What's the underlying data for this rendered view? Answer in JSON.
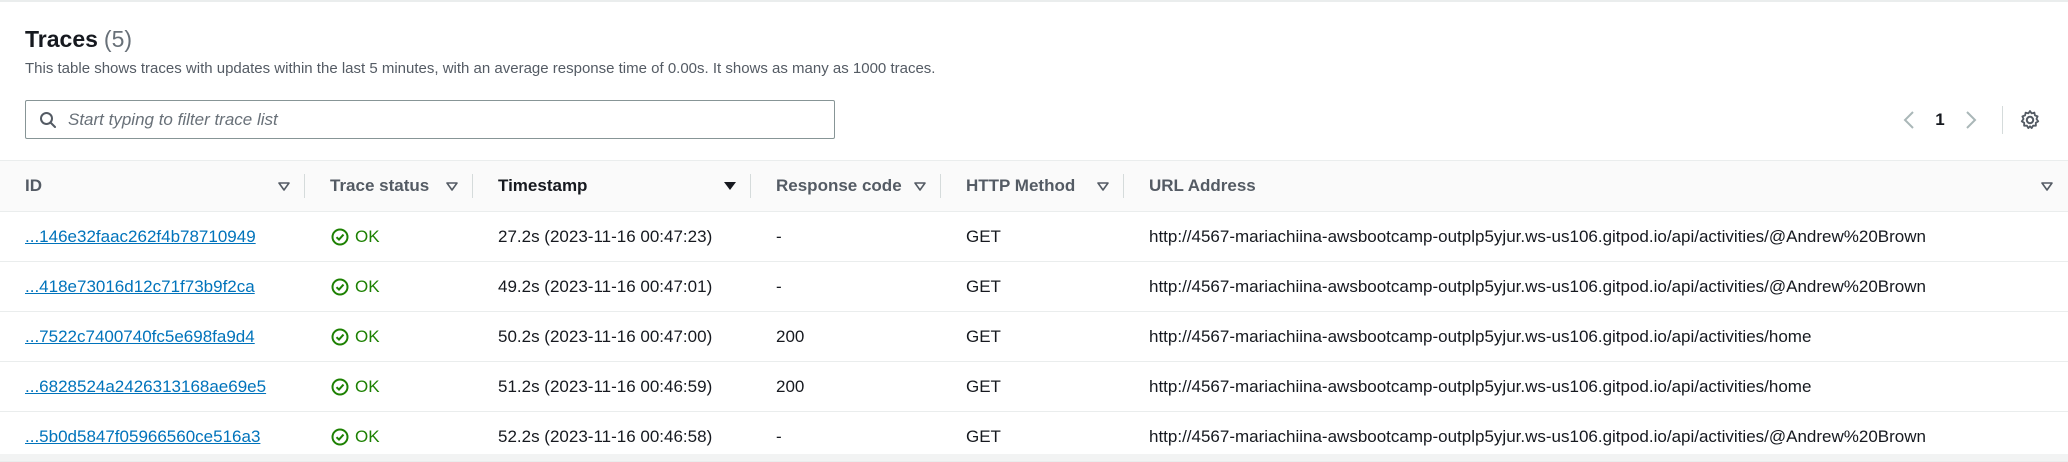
{
  "header": {
    "title": "Traces",
    "count": "(5)",
    "description": "This table shows traces with updates within the last 5 minutes, with an average response time of 0.00s. It shows as many as 1000 traces."
  },
  "filter": {
    "placeholder": "Start typing to filter trace list",
    "value": ""
  },
  "pagination": {
    "current_page": "1"
  },
  "columns": [
    {
      "label": "ID"
    },
    {
      "label": "Trace status"
    },
    {
      "label": "Timestamp"
    },
    {
      "label": "Response code"
    },
    {
      "label": "HTTP Method"
    },
    {
      "label": "URL Address"
    }
  ],
  "rows": [
    {
      "id": "...146e32faac262f4b78710949",
      "status": "OK",
      "timestamp": "27.2s (2023-11-16 00:47:23)",
      "response_code": "-",
      "method": "GET",
      "url": "http://4567-mariachiina-awsbootcamp-outplp5yjur.ws-us106.gitpod.io/api/activities/@Andrew%20Brown"
    },
    {
      "id": "...418e73016d12c71f73b9f2ca",
      "status": "OK",
      "timestamp": "49.2s (2023-11-16 00:47:01)",
      "response_code": "-",
      "method": "GET",
      "url": "http://4567-mariachiina-awsbootcamp-outplp5yjur.ws-us106.gitpod.io/api/activities/@Andrew%20Brown"
    },
    {
      "id": "...7522c7400740fc5e698fa9d4",
      "status": "OK",
      "timestamp": "50.2s (2023-11-16 00:47:00)",
      "response_code": "200",
      "method": "GET",
      "url": "http://4567-mariachiina-awsbootcamp-outplp5yjur.ws-us106.gitpod.io/api/activities/home"
    },
    {
      "id": "...6828524a2426313168ae69e5",
      "status": "OK",
      "timestamp": "51.2s (2023-11-16 00:46:59)",
      "response_code": "200",
      "method": "GET",
      "url": "http://4567-mariachiina-awsbootcamp-outplp5yjur.ws-us106.gitpod.io/api/activities/home"
    },
    {
      "id": "...5b0d5847f05966560ce516a3",
      "status": "OK",
      "timestamp": "52.2s (2023-11-16 00:46:58)",
      "response_code": "-",
      "method": "GET",
      "url": "http://4567-mariachiina-awsbootcamp-outplp5yjur.ws-us106.gitpod.io/api/activities/@Andrew%20Brown"
    }
  ],
  "icons": {
    "search": "search-icon",
    "prev": "chevron-left-icon",
    "next": "chevron-right-icon",
    "settings": "gear-icon",
    "sort": "caret-down-icon",
    "status_ok": "check-circle-icon"
  },
  "colors": {
    "link": "#0073bb",
    "status_ok": "#1d8102",
    "header_text": "#545b64"
  }
}
